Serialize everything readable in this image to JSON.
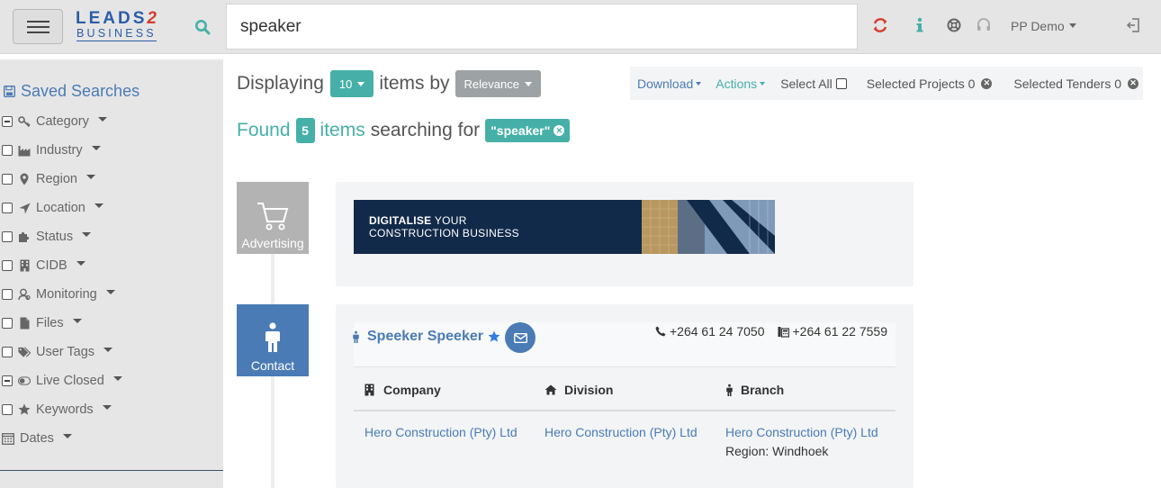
{
  "header": {
    "logo_top": "LEADS",
    "logo_top_accent": "2",
    "logo_bottom": "BUSINESS",
    "search_value": "speaker",
    "user": "PP Demo"
  },
  "sidebar": {
    "saved_searches": "Saved Searches",
    "filters": [
      {
        "label": "Category",
        "icon": "key-icon",
        "checkbox": "indeterminate"
      },
      {
        "label": "Industry",
        "icon": "industry-icon",
        "checkbox": "unchecked"
      },
      {
        "label": "Region",
        "icon": "map-marker-icon",
        "checkbox": "unchecked"
      },
      {
        "label": "Location",
        "icon": "location-arrow-icon",
        "checkbox": "unchecked"
      },
      {
        "label": "Status",
        "icon": "puzzle-icon",
        "checkbox": "unchecked"
      },
      {
        "label": "CIDB",
        "icon": "building-icon",
        "checkbox": "unchecked"
      },
      {
        "label": "Monitoring",
        "icon": "monitor-user-icon",
        "checkbox": "unchecked"
      },
      {
        "label": "Files",
        "icon": "file-icon",
        "checkbox": "unchecked"
      },
      {
        "label": "User Tags",
        "icon": "tags-icon",
        "checkbox": "unchecked"
      },
      {
        "label": "Live Closed",
        "icon": "toggle-icon",
        "checkbox": "indeterminate"
      },
      {
        "label": "Keywords",
        "icon": "star-icon",
        "checkbox": "unchecked"
      },
      {
        "label": "Dates",
        "icon": "calendar-icon",
        "checkbox": "none"
      }
    ]
  },
  "results": {
    "displaying_label": "Displaying",
    "page_size": "10",
    "items_by_label": "items by",
    "sort": "Relevance",
    "found_label": "Found",
    "found_count": "5",
    "items_label": "items",
    "searching_for_label": "searching for",
    "query_tag": "\"speaker\""
  },
  "toolbar": {
    "download": "Download",
    "actions": "Actions",
    "select_all": "Select All",
    "selected_projects": "Selected Projects 0",
    "selected_tenders": "Selected Tenders 0"
  },
  "cards": {
    "advertising_label": "Advertising",
    "banner_line1_bold": "DIGITALISE",
    "banner_line1_rest": " YOUR",
    "banner_line2": "CONSTRUCTION BUSINESS",
    "contact_label": "Contact",
    "person_name": "Speeker Speeker",
    "phone": "+264 61 24 7050",
    "fax": "+264 61 22 7559",
    "col_company": "Company",
    "col_division": "Division",
    "col_branch": "Branch",
    "company": "Hero Construction (Pty) Ltd",
    "division": "Hero Construction (Pty) Ltd",
    "branch": "Hero Construction (Pty) Ltd",
    "region": "Region: Windhoek"
  },
  "colors": {
    "accent_teal": "#46b0a8",
    "accent_blue": "#4a7bb5",
    "refresh_red": "#d63c2f"
  }
}
